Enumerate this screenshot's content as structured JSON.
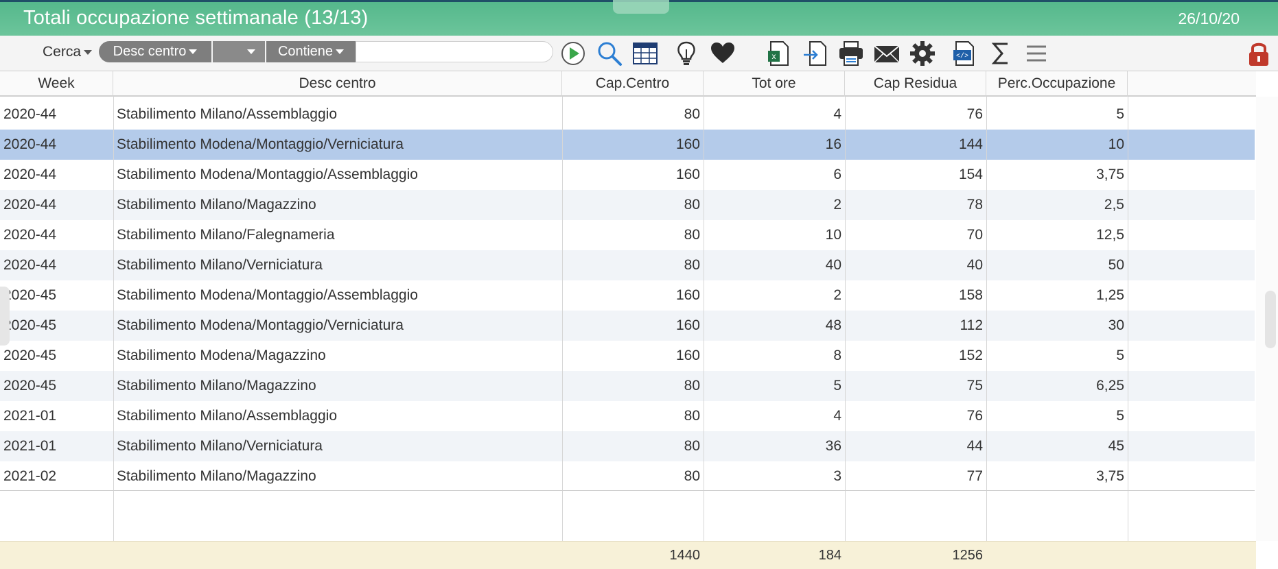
{
  "window": {
    "title": "Totali occupazione settimanale (13/13)",
    "date": "26/10/20"
  },
  "toolbar": {
    "search_label": "Cerca",
    "field_select": "Desc centro",
    "operator_blank": "",
    "operator_select": "Contiene",
    "search_value": "",
    "icons": [
      "play-icon",
      "magnifier-icon",
      "table-icon",
      "lightbulb-icon",
      "heart-icon",
      "excel-icon",
      "export-icon",
      "print-icon",
      "mail-icon",
      "gear-icon",
      "code-icon",
      "sigma-icon",
      "menu-icon",
      "lock-icon"
    ]
  },
  "table": {
    "columns": [
      "Week",
      "Desc centro",
      "Cap.Centro",
      "Tot ore",
      "Cap Residua",
      "Perc.Occupazione"
    ],
    "rows": [
      [
        "2020-44",
        "Stabilimento Milano/Assemblaggio",
        "80",
        "4",
        "76",
        "5"
      ],
      [
        "2020-44",
        "Stabilimento Modena/Montaggio/Verniciatura",
        "160",
        "16",
        "144",
        "10"
      ],
      [
        "2020-44",
        "Stabilimento Modena/Montaggio/Assemblaggio",
        "160",
        "6",
        "154",
        "3,75"
      ],
      [
        "2020-44",
        "Stabilimento Milano/Magazzino",
        "80",
        "2",
        "78",
        "2,5"
      ],
      [
        "2020-44",
        "Stabilimento Milano/Falegnameria",
        "80",
        "10",
        "70",
        "12,5"
      ],
      [
        "2020-44",
        "Stabilimento Milano/Verniciatura",
        "80",
        "40",
        "40",
        "50"
      ],
      [
        "2020-45",
        "Stabilimento Modena/Montaggio/Assemblaggio",
        "160",
        "2",
        "158",
        "1,25"
      ],
      [
        "2020-45",
        "Stabilimento Modena/Montaggio/Verniciatura",
        "160",
        "48",
        "112",
        "30"
      ],
      [
        "2020-45",
        "Stabilimento Modena/Magazzino",
        "160",
        "8",
        "152",
        "5"
      ],
      [
        "2020-45",
        "Stabilimento Milano/Magazzino",
        "80",
        "5",
        "75",
        "6,25"
      ],
      [
        "2021-01",
        "Stabilimento Milano/Assemblaggio",
        "80",
        "4",
        "76",
        "5"
      ],
      [
        "2021-01",
        "Stabilimento Milano/Verniciatura",
        "80",
        "36",
        "44",
        "45"
      ],
      [
        "2021-02",
        "Stabilimento Milano/Magazzino",
        "80",
        "3",
        "77",
        "3,75"
      ]
    ],
    "selected_row": 1,
    "totals": [
      "",
      "",
      "1440",
      "184",
      "1256",
      ""
    ]
  },
  "colors": {
    "title_bar": "#6cc59b",
    "selected_row": "#b4cbea",
    "totals_bg": "#f7f1d8",
    "lock": "#c0392b"
  }
}
